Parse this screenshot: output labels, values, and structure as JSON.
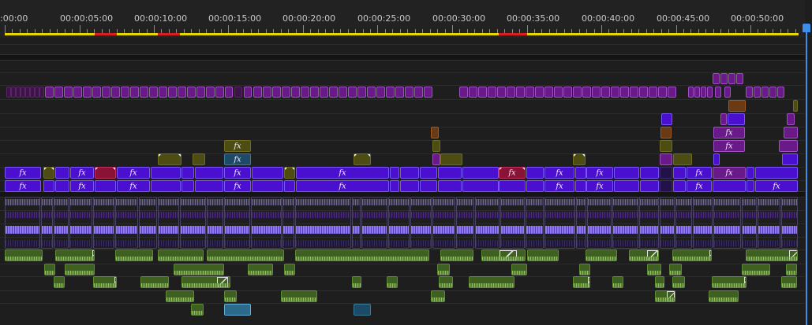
{
  "ruler": {
    "labels": [
      ":00:00",
      "00:00:05:00",
      "00:00:10:00",
      "00:00:15:00",
      "00:00:20:00",
      "00:00:25:00",
      "00:00:30:00",
      "00:00:35:00",
      "00:00:40:00",
      "00:00:45:00",
      "00:00:50:00"
    ]
  },
  "colors": {
    "work_area": "#e5d800",
    "render_needed": "#d81e1e",
    "playhead": "#3d8ee8",
    "video_clip": "#4b0fcf",
    "nested_clip": "#6a1a88",
    "adjustment_clip": "#4d4c12",
    "audio_clip": "#3e6020"
  },
  "icons": {
    "playhead": "playhead-icon",
    "effect_badge": "fx-badge-icon",
    "transition": "transition-icon"
  },
  "clip_badges": {
    "fx": "fx"
  }
}
